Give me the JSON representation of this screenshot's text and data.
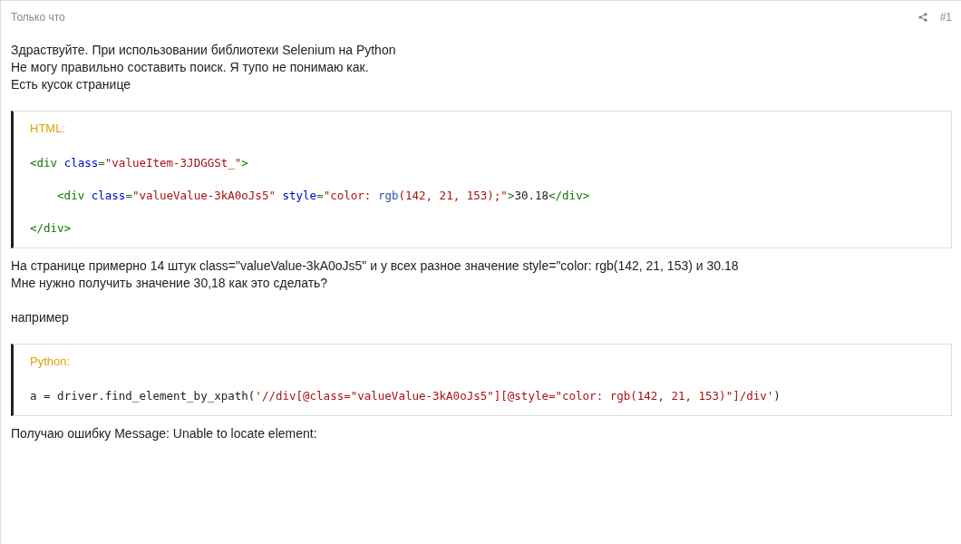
{
  "post": {
    "time": "Только что",
    "number": "#1"
  },
  "blocks": [
    {
      "kind": "text",
      "lines": [
        "Здраствуйте. При использовании библиотеки Selenium на Python",
        "Не могу правильно составить поиск. Я тупо не понимаю как.",
        "Есть кусок странице"
      ]
    },
    {
      "kind": "code",
      "language": "HTML:",
      "lines": [
        {
          "indent": false,
          "tokens": [
            {
              "kind": "tag",
              "s": "<div "
            },
            {
              "kind": "attr",
              "s": "class"
            },
            {
              "kind": "tag",
              "s": "="
            },
            {
              "kind": "str",
              "s": "\"valueItem-3JDGGSt_\""
            },
            {
              "kind": "tag",
              "s": ">"
            }
          ]
        },
        {
          "indent": true,
          "tokens": [
            {
              "kind": "tag",
              "s": "<div "
            },
            {
              "kind": "attr",
              "s": "class"
            },
            {
              "kind": "tag",
              "s": "="
            },
            {
              "kind": "str",
              "s": "\"valueValue-3kA0oJs5\" "
            },
            {
              "kind": "attr",
              "s": "style"
            },
            {
              "kind": "tag",
              "s": "="
            },
            {
              "kind": "str",
              "s": "\"color: "
            },
            {
              "kind": "func",
              "s": "rgb"
            },
            {
              "kind": "str",
              "s": "(142, 21, 153);\""
            },
            {
              "kind": "tag",
              "s": ">"
            },
            {
              "kind": "plain",
              "s": "30.18"
            },
            {
              "kind": "tag",
              "s": "</div>"
            }
          ]
        },
        {
          "indent": false,
          "tokens": [
            {
              "kind": "tag",
              "s": "</div>"
            }
          ]
        }
      ]
    },
    {
      "kind": "text",
      "lines": [
        "На странице примерно 14 штук class=\"valueValue-3kA0oJs5\" и у всех разное значение style=\"color: rgb(142, 21, 153) и 30.18",
        "Мне нужно получить значение 30,18 как это сделать?"
      ]
    },
    {
      "kind": "text",
      "lines": [
        "например"
      ]
    },
    {
      "kind": "code",
      "language": "Python:",
      "lines": [
        {
          "indent": false,
          "tokens": [
            {
              "kind": "plain",
              "s": "a = driver.find_element_by_xpath("
            },
            {
              "kind": "str",
              "s": "'//div[@class=\"valueValue-3kA0oJs5\"][@style=\"color: rgb(142, 21, 153)\"]/div'"
            },
            {
              "kind": "plain",
              "s": ")"
            }
          ]
        }
      ]
    },
    {
      "kind": "text",
      "lines": [
        "Получаю ошибку Message: Unable to locate element:"
      ]
    }
  ]
}
